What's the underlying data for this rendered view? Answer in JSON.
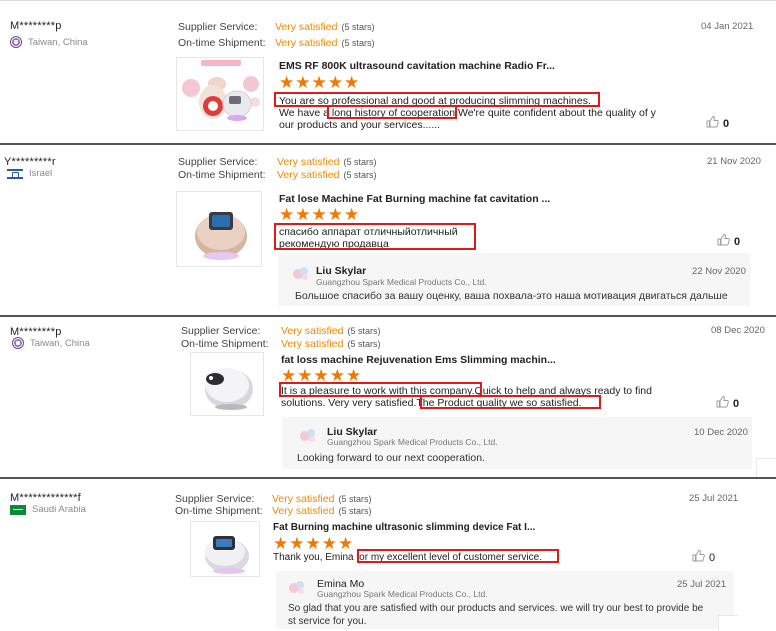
{
  "labels": {
    "supplier_service": "Supplier Service:",
    "on_time_shipment": "On-time Shipment:",
    "stars_note": "(5 stars)",
    "very_satisfied": "Very satisfied",
    "stars_glyphs": "★★★★★",
    "like_icon": "thumbs-up-outline-icon"
  },
  "colors": {
    "accent": "#f08a00",
    "star": "#f07a00",
    "highlight": "#e01a1a"
  },
  "reviews": [
    {
      "buyer": "M********p",
      "country": "Taiwan, China",
      "date": "04 Jan 2021",
      "product_title": "EMS RF 800K ultrasound cavitation machine Radio Fr...",
      "comment_lines": [
        "You are so professional and good at producing slimming machines.",
        "We have a long history of cooperation.We're quite confident about the quality of y",
        "our products and your services......"
      ],
      "likes": "0",
      "reply": null
    },
    {
      "buyer": "Y*********r",
      "country": "Israel",
      "date": "21 Nov 2020",
      "product_title": "Fat lose Machine Fat Burning machine fat cavitation ...",
      "comment_lines": [
        "спасибо  аппарат отличныйотличный",
        "рекомендую продавца"
      ],
      "likes": "0",
      "reply": {
        "name": "Liu Skylar",
        "company": "Guangzhou Spark Medical Products Co., Ltd.",
        "date": "22 Nov 2020",
        "text": "Большое спасибо за вашу оценку, ваша похвала-это наша мотивация двигаться дальше"
      }
    },
    {
      "buyer": "M********p",
      "country": "Taiwan, China",
      "date": "08 Dec 2020",
      "product_title": "fat loss machine Rejuvenation Ems Slimming machin...",
      "comment_lines": [
        "It is a pleasure to work with this company.Quick to help and always ready to find",
        "solutions. Very very satisfied.The Product quality we so satisfied."
      ],
      "likes": "0",
      "reply": {
        "name": "Liu Skylar",
        "company": "Guangzhou Spark Medical Products Co., Ltd.",
        "date": "10 Dec 2020",
        "text": "Looking forward to our next cooperation."
      }
    },
    {
      "buyer": "M*************f",
      "country": "Saudi Arabia",
      "date": "25 Jul 2021",
      "product_title": "Fat Burning machine ultrasonic slimming device Fat I...",
      "comment_lines": [
        "Thank you, Emina  for my excellent level of customer service."
      ],
      "likes": "0",
      "reply": {
        "name": "Emina Mo",
        "company": "Guangzhou Spark Medical Products Co., Ltd.",
        "date": "25 Jul 2021",
        "text_lines": [
          "So glad that you are satisfied with our products and services. we will try our best to provide be",
          "st service for you."
        ]
      }
    }
  ]
}
